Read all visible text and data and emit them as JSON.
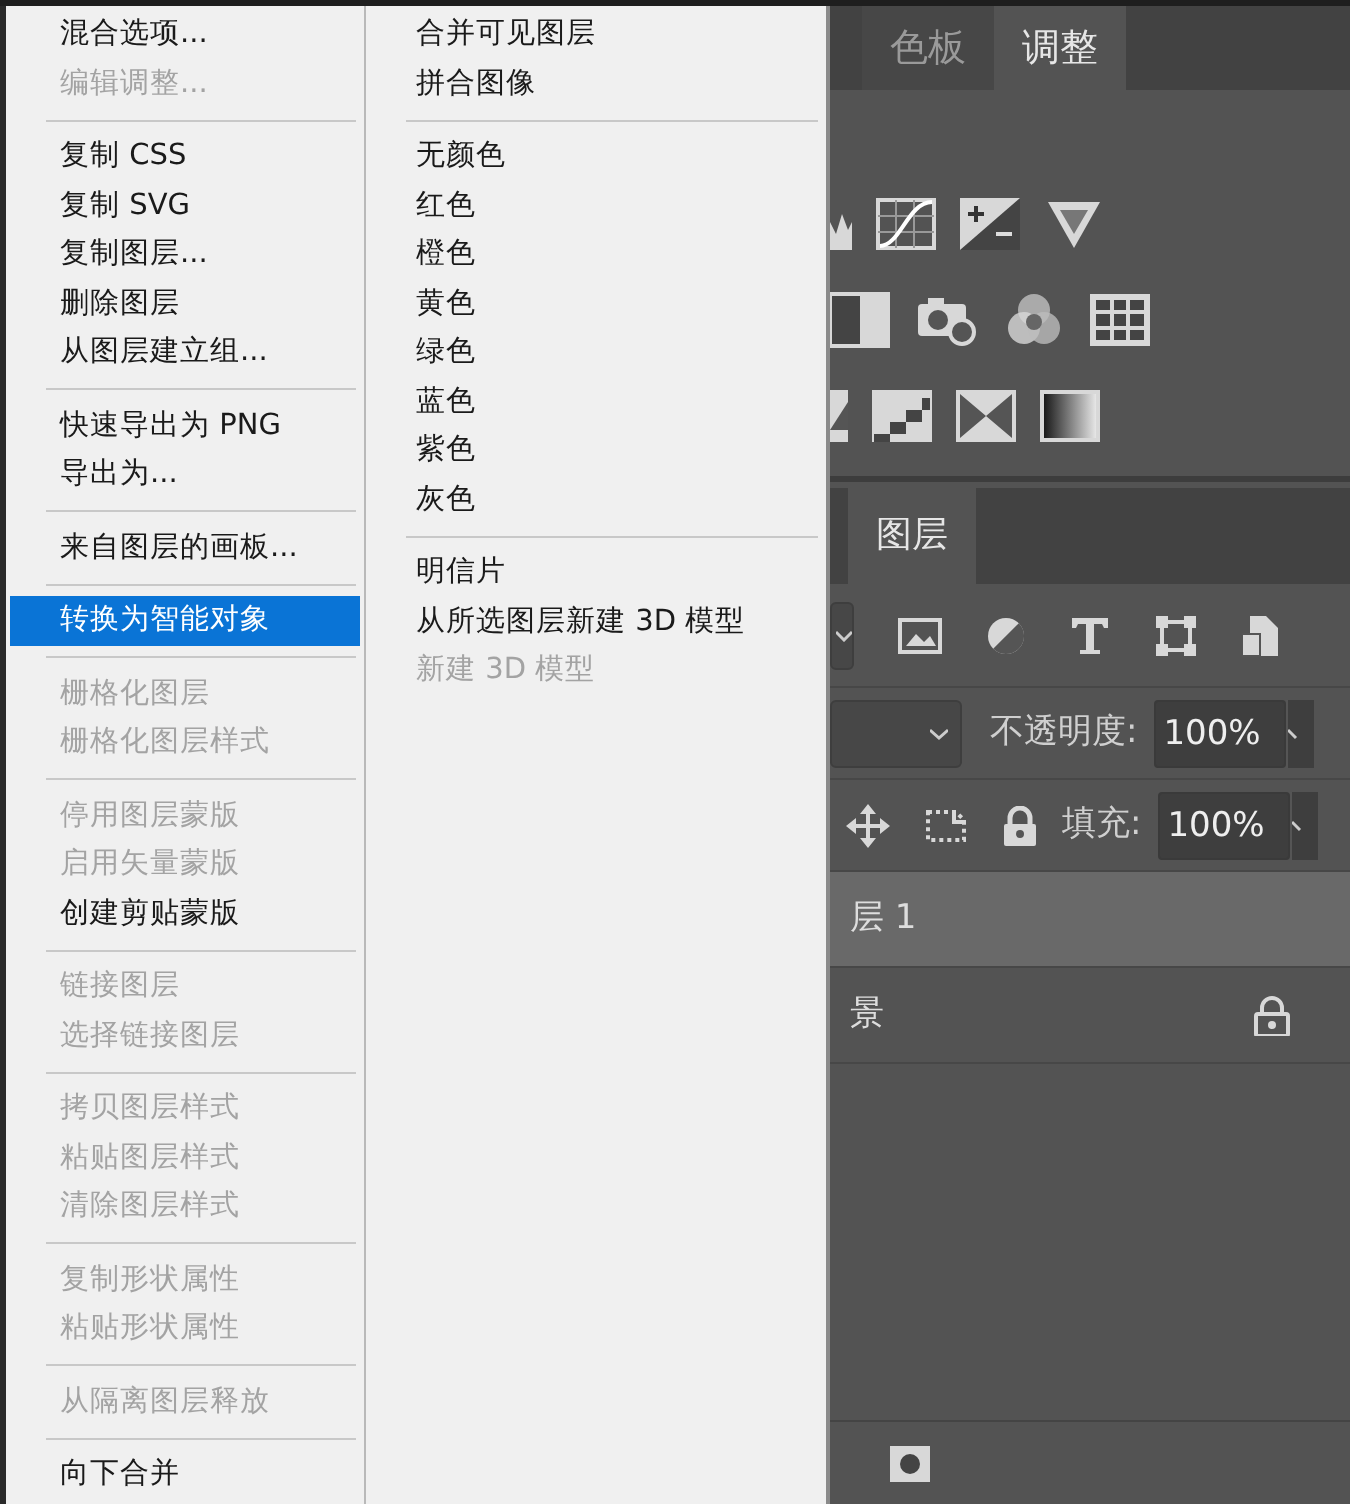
{
  "menus": [
    {
      "groups": [
        {
          "items": [
            {
              "label": "混合选项...",
              "disabled": false,
              "selected": false
            },
            {
              "label": "编辑调整...",
              "disabled": true,
              "selected": false
            }
          ]
        },
        {
          "items": [
            {
              "label": "复制 CSS",
              "disabled": false,
              "selected": false
            },
            {
              "label": "复制 SVG",
              "disabled": false,
              "selected": false
            },
            {
              "label": "复制图层...",
              "disabled": false,
              "selected": false
            },
            {
              "label": "删除图层",
              "disabled": false,
              "selected": false
            },
            {
              "label": "从图层建立组...",
              "disabled": false,
              "selected": false
            }
          ]
        },
        {
          "items": [
            {
              "label": "快速导出为 PNG",
              "disabled": false,
              "selected": false
            },
            {
              "label": "导出为...",
              "disabled": false,
              "selected": false
            }
          ]
        },
        {
          "items": [
            {
              "label": "来自图层的画板...",
              "disabled": false,
              "selected": false
            }
          ]
        },
        {
          "items": [
            {
              "label": "转换为智能对象",
              "disabled": false,
              "selected": true
            }
          ]
        },
        {
          "items": [
            {
              "label": "栅格化图层",
              "disabled": true,
              "selected": false
            },
            {
              "label": "栅格化图层样式",
              "disabled": true,
              "selected": false
            }
          ]
        },
        {
          "items": [
            {
              "label": "停用图层蒙版",
              "disabled": true,
              "selected": false
            },
            {
              "label": "启用矢量蒙版",
              "disabled": true,
              "selected": false
            },
            {
              "label": "创建剪贴蒙版",
              "disabled": false,
              "selected": false
            }
          ]
        },
        {
          "items": [
            {
              "label": "链接图层",
              "disabled": true,
              "selected": false
            },
            {
              "label": "选择链接图层",
              "disabled": true,
              "selected": false
            }
          ]
        },
        {
          "items": [
            {
              "label": "拷贝图层样式",
              "disabled": true,
              "selected": false
            },
            {
              "label": "粘贴图层样式",
              "disabled": true,
              "selected": false
            },
            {
              "label": "清除图层样式",
              "disabled": true,
              "selected": false
            }
          ]
        },
        {
          "items": [
            {
              "label": "复制形状属性",
              "disabled": true,
              "selected": false
            },
            {
              "label": "粘贴形状属性",
              "disabled": true,
              "selected": false
            }
          ]
        },
        {
          "items": [
            {
              "label": "从隔离图层释放",
              "disabled": true,
              "selected": false
            }
          ]
        },
        {
          "items": [
            {
              "label": "向下合并",
              "disabled": false,
              "selected": false
            }
          ]
        }
      ]
    },
    {
      "groups": [
        {
          "items": [
            {
              "label": "合并可见图层",
              "disabled": false,
              "selected": false
            },
            {
              "label": "拼合图像",
              "disabled": false,
              "selected": false
            }
          ]
        },
        {
          "items": [
            {
              "label": "无颜色",
              "disabled": false,
              "selected": false
            },
            {
              "label": "红色",
              "disabled": false,
              "selected": false
            },
            {
              "label": "橙色",
              "disabled": false,
              "selected": false
            },
            {
              "label": "黄色",
              "disabled": false,
              "selected": false
            },
            {
              "label": "绿色",
              "disabled": false,
              "selected": false
            },
            {
              "label": "蓝色",
              "disabled": false,
              "selected": false
            },
            {
              "label": "紫色",
              "disabled": false,
              "selected": false
            },
            {
              "label": "灰色",
              "disabled": false,
              "selected": false
            }
          ]
        },
        {
          "items": [
            {
              "label": "明信片",
              "disabled": false,
              "selected": false
            },
            {
              "label": "从所选图层新建 3D 模型",
              "disabled": false,
              "selected": false
            },
            {
              "label": "新建 3D 模型",
              "disabled": true,
              "selected": false
            }
          ]
        }
      ]
    }
  ],
  "adjustments_panel": {
    "tabs": [
      {
        "label": "色板",
        "selected": false
      },
      {
        "label": "调整",
        "selected": true
      }
    ]
  },
  "layers_panel": {
    "tabs": [
      {
        "label": "图层",
        "selected": true
      }
    ],
    "opacity_label": "不透明度:",
    "opacity": "100%",
    "fill_label": "填充:",
    "fill": "100%",
    "layers": [
      {
        "name": "层 1",
        "selected": true,
        "locked": false
      },
      {
        "name": "景",
        "selected": false,
        "locked": true
      }
    ]
  }
}
